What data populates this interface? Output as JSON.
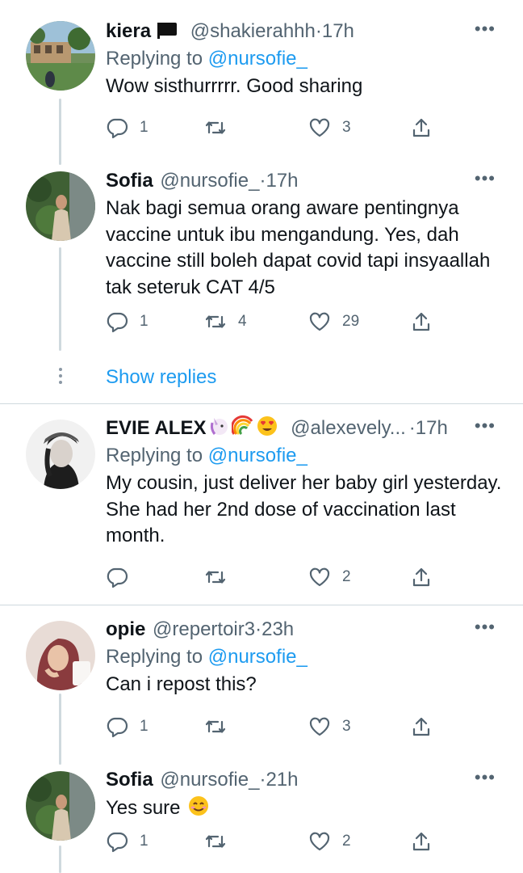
{
  "tweets": [
    {
      "name": "kiera",
      "handle": "@shakierahhh",
      "time": "17h",
      "replying_label": "Replying to",
      "replying_to": "@nursofie_",
      "text": "Wow sisthurrrrr. Good sharing",
      "replies": "1",
      "retweets": "",
      "likes": "3",
      "name_icon": "black-flag-icon"
    },
    {
      "name": "Sofia",
      "handle": "@nursofie_",
      "time": "17h",
      "text": "Nak bagi semua orang aware pentingnya vaccine untuk ibu mengandung. Yes, dah vaccine still boleh dapat covid tapi insyaallah tak seteruk CAT 4/5",
      "replies": "1",
      "retweets": "4",
      "likes": "29"
    },
    {
      "name": "EVIE ALEX",
      "handle": "@alexevely...",
      "time": "17h",
      "replying_label": "Replying to",
      "replying_to": "@nursofie_",
      "text": "My cousin, just deliver her baby girl yesterday. She had her 2nd dose of vaccination last month.",
      "replies": "",
      "retweets": "",
      "likes": "2",
      "name_icons": [
        "unicorn-emoji-icon",
        "rainbow-emoji-icon",
        "heart-eyes-emoji-icon"
      ]
    },
    {
      "name": "opie",
      "handle": "@repertoir3",
      "time": "23h",
      "replying_label": "Replying to",
      "replying_to": "@nursofie_",
      "text": "Can i repost this?",
      "replies": "1",
      "retweets": "",
      "likes": "3"
    },
    {
      "name": "Sofia",
      "handle": "@nursofie_",
      "time": "21h",
      "text": "Yes sure",
      "text_emoji": "smiling-emoji-icon",
      "replies": "1",
      "retweets": "",
      "likes": "2"
    }
  ],
  "show_replies": "Show replies",
  "more_glyph": "•••",
  "dot_separator": "·",
  "colors": {
    "accent": "#1d9bf0",
    "secondary_text": "#536471",
    "divider": "#cfd9de"
  }
}
